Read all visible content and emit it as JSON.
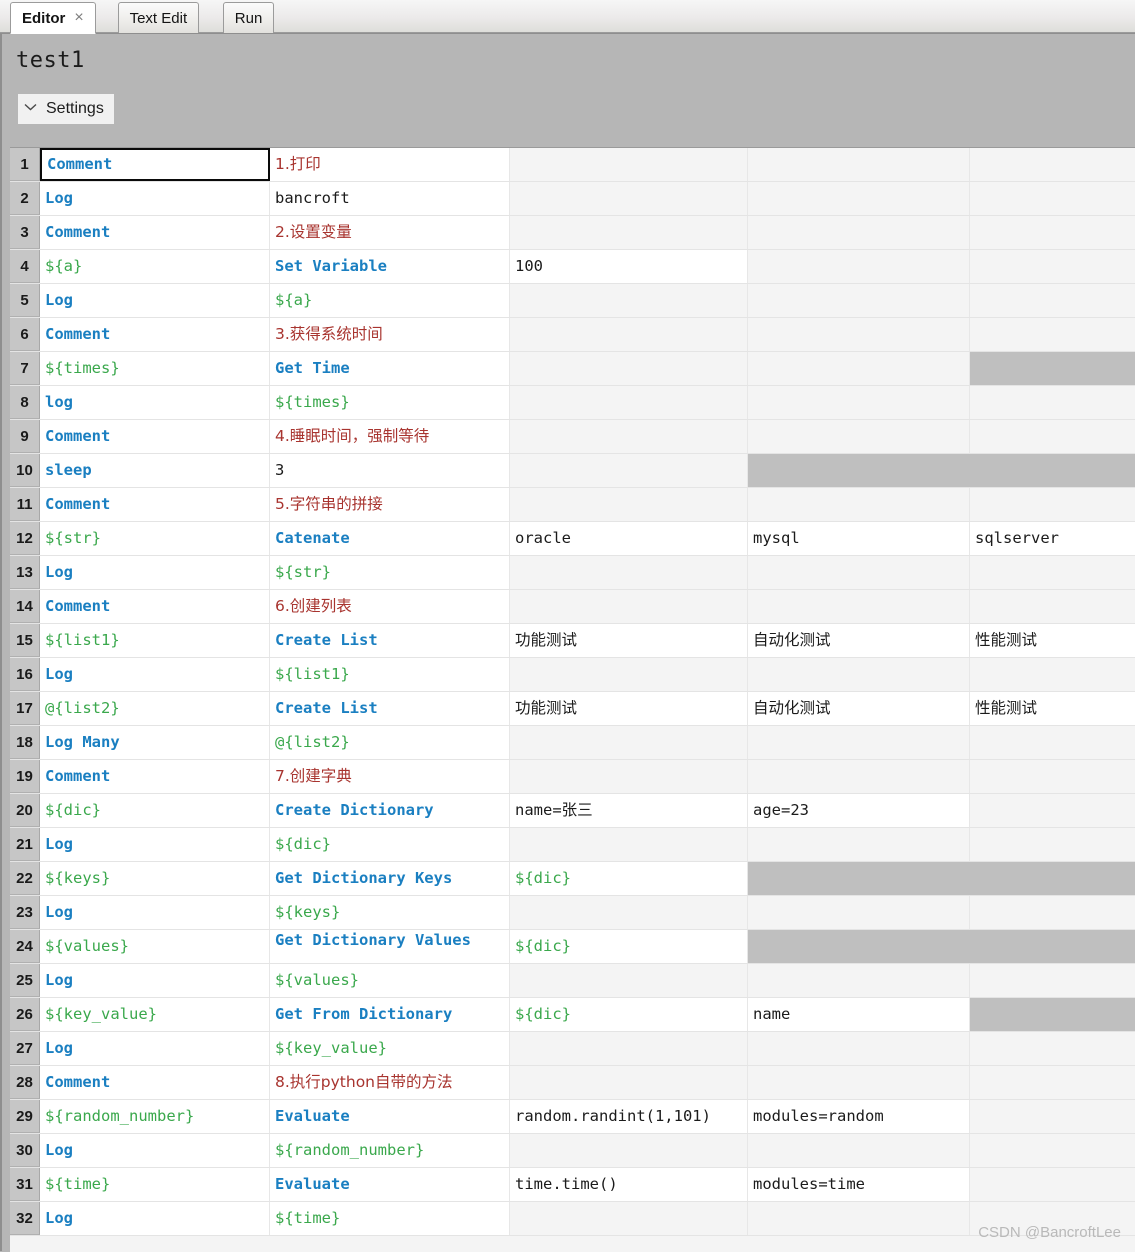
{
  "window": {
    "tabs": [
      {
        "label": "Editor",
        "active": true,
        "closable": true
      },
      {
        "label": "Text Edit",
        "active": false,
        "closable": false
      },
      {
        "label": "Run",
        "active": false,
        "closable": false
      }
    ]
  },
  "editor": {
    "suite_title": "test1",
    "settings_label": "Settings",
    "settings_icon": "chevron-down-icon"
  },
  "colors": {
    "keyword": "#1a7fc1",
    "variable": "#3aa84c",
    "comment": "#a8342f",
    "plain": "#1b1b1b",
    "disabled_cell": "#bfbfbf",
    "empty_cell": "#f4f4f4",
    "row_header": "#c6c6c6",
    "panel": "#b6b6b6"
  },
  "watermark": "CSDN @BancroftLee",
  "grid": {
    "columns": 5,
    "rows": [
      {
        "n": "1",
        "cells": [
          {
            "t": "Comment",
            "k": "kw",
            "sel": true
          },
          {
            "t": "1.打印",
            "k": "cmt",
            "cjk": true
          },
          {
            "t": "",
            "k": ""
          },
          {
            "t": "",
            "k": ""
          },
          {
            "t": "",
            "k": ""
          }
        ]
      },
      {
        "n": "2",
        "cells": [
          {
            "t": "Log",
            "k": "kw"
          },
          {
            "t": "bancroft",
            "k": "txt"
          },
          {
            "t": "",
            "k": ""
          },
          {
            "t": "",
            "k": ""
          },
          {
            "t": "",
            "k": ""
          }
        ]
      },
      {
        "n": "3",
        "cells": [
          {
            "t": "Comment",
            "k": "kw"
          },
          {
            "t": "2.设置变量",
            "k": "cmt",
            "cjk": true
          },
          {
            "t": "",
            "k": ""
          },
          {
            "t": "",
            "k": ""
          },
          {
            "t": "",
            "k": ""
          }
        ]
      },
      {
        "n": "4",
        "cells": [
          {
            "t": "${a}",
            "k": "var"
          },
          {
            "t": "Set Variable",
            "k": "kw"
          },
          {
            "t": "100",
            "k": "txt"
          },
          {
            "t": "",
            "k": ""
          },
          {
            "t": "",
            "k": ""
          }
        ]
      },
      {
        "n": "5",
        "cells": [
          {
            "t": "Log",
            "k": "kw"
          },
          {
            "t": "${a}",
            "k": "var"
          },
          {
            "t": "",
            "k": ""
          },
          {
            "t": "",
            "k": ""
          },
          {
            "t": "",
            "k": ""
          }
        ]
      },
      {
        "n": "6",
        "cells": [
          {
            "t": "Comment",
            "k": "kw"
          },
          {
            "t": "3.获得系统时间",
            "k": "cmt",
            "cjk": true
          },
          {
            "t": "",
            "k": ""
          },
          {
            "t": "",
            "k": ""
          },
          {
            "t": "",
            "k": ""
          }
        ]
      },
      {
        "n": "7",
        "cells": [
          {
            "t": "${times}",
            "k": "var"
          },
          {
            "t": "Get Time",
            "k": "kw"
          },
          {
            "t": "",
            "k": ""
          },
          {
            "t": "",
            "k": ""
          },
          {
            "t": "",
            "k": "",
            "dis": true
          }
        ]
      },
      {
        "n": "8",
        "cells": [
          {
            "t": "log",
            "k": "kw"
          },
          {
            "t": "${times}",
            "k": "var"
          },
          {
            "t": "",
            "k": ""
          },
          {
            "t": "",
            "k": ""
          },
          {
            "t": "",
            "k": ""
          }
        ]
      },
      {
        "n": "9",
        "cells": [
          {
            "t": "Comment",
            "k": "kw"
          },
          {
            "t": "4.睡眠时间，强制等待",
            "k": "cmt",
            "cjk": true
          },
          {
            "t": "",
            "k": ""
          },
          {
            "t": "",
            "k": ""
          },
          {
            "t": "",
            "k": ""
          }
        ]
      },
      {
        "n": "10",
        "cells": [
          {
            "t": "sleep",
            "k": "kw"
          },
          {
            "t": "3",
            "k": "txt"
          },
          {
            "t": "",
            "k": ""
          },
          {
            "t": "",
            "k": "",
            "dis": true
          },
          {
            "t": "",
            "k": "",
            "dis": true
          }
        ]
      },
      {
        "n": "11",
        "cells": [
          {
            "t": "Comment",
            "k": "kw"
          },
          {
            "t": "5.字符串的拼接",
            "k": "cmt",
            "cjk": true
          },
          {
            "t": "",
            "k": ""
          },
          {
            "t": "",
            "k": ""
          },
          {
            "t": "",
            "k": ""
          }
        ]
      },
      {
        "n": "12",
        "cells": [
          {
            "t": "${str}",
            "k": "var"
          },
          {
            "t": "Catenate",
            "k": "kw"
          },
          {
            "t": "oracle",
            "k": "txt"
          },
          {
            "t": "mysql",
            "k": "txt"
          },
          {
            "t": "sqlserver",
            "k": "txt"
          }
        ]
      },
      {
        "n": "13",
        "cells": [
          {
            "t": "Log",
            "k": "kw"
          },
          {
            "t": "${str}",
            "k": "var"
          },
          {
            "t": "",
            "k": ""
          },
          {
            "t": "",
            "k": ""
          },
          {
            "t": "",
            "k": ""
          }
        ]
      },
      {
        "n": "14",
        "cells": [
          {
            "t": "Comment",
            "k": "kw"
          },
          {
            "t": "6.创建列表",
            "k": "cmt",
            "cjk": true
          },
          {
            "t": "",
            "k": ""
          },
          {
            "t": "",
            "k": ""
          },
          {
            "t": "",
            "k": ""
          }
        ]
      },
      {
        "n": "15",
        "cells": [
          {
            "t": "${list1}",
            "k": "var"
          },
          {
            "t": "Create List",
            "k": "kw"
          },
          {
            "t": "功能测试",
            "k": "txt",
            "cjk": true
          },
          {
            "t": "自动化测试",
            "k": "txt",
            "cjk": true
          },
          {
            "t": "性能测试",
            "k": "txt",
            "cjk": true
          }
        ]
      },
      {
        "n": "16",
        "cells": [
          {
            "t": "Log",
            "k": "kw"
          },
          {
            "t": "${list1}",
            "k": "var"
          },
          {
            "t": "",
            "k": ""
          },
          {
            "t": "",
            "k": ""
          },
          {
            "t": "",
            "k": ""
          }
        ]
      },
      {
        "n": "17",
        "cells": [
          {
            "t": "@{list2}",
            "k": "var"
          },
          {
            "t": "Create List",
            "k": "kw"
          },
          {
            "t": "功能测试",
            "k": "txt",
            "cjk": true
          },
          {
            "t": "自动化测试",
            "k": "txt",
            "cjk": true
          },
          {
            "t": "性能测试",
            "k": "txt",
            "cjk": true
          }
        ]
      },
      {
        "n": "18",
        "cells": [
          {
            "t": "Log Many",
            "k": "kw"
          },
          {
            "t": "@{list2}",
            "k": "var"
          },
          {
            "t": "",
            "k": ""
          },
          {
            "t": "",
            "k": ""
          },
          {
            "t": "",
            "k": ""
          }
        ]
      },
      {
        "n": "19",
        "cells": [
          {
            "t": "Comment",
            "k": "kw"
          },
          {
            "t": "7.创建字典",
            "k": "cmt",
            "cjk": true
          },
          {
            "t": "",
            "k": ""
          },
          {
            "t": "",
            "k": ""
          },
          {
            "t": "",
            "k": ""
          }
        ]
      },
      {
        "n": "20",
        "cells": [
          {
            "t": "${dic}",
            "k": "var"
          },
          {
            "t": "Create Dictionary",
            "k": "kw"
          },
          {
            "t": "name=张三",
            "k": "txt"
          },
          {
            "t": "age=23",
            "k": "txt"
          },
          {
            "t": "",
            "k": ""
          }
        ]
      },
      {
        "n": "21",
        "cells": [
          {
            "t": "Log",
            "k": "kw"
          },
          {
            "t": "${dic}",
            "k": "var"
          },
          {
            "t": "",
            "k": ""
          },
          {
            "t": "",
            "k": ""
          },
          {
            "t": "",
            "k": ""
          }
        ]
      },
      {
        "n": "22",
        "cells": [
          {
            "t": "${keys}",
            "k": "var"
          },
          {
            "t": "Get Dictionary Keys",
            "k": "kw"
          },
          {
            "t": "${dic}",
            "k": "var"
          },
          {
            "t": "",
            "k": "",
            "dis": true
          },
          {
            "t": "",
            "k": "",
            "dis": true
          }
        ]
      },
      {
        "n": "23",
        "cells": [
          {
            "t": "Log",
            "k": "kw"
          },
          {
            "t": "${keys}",
            "k": "var"
          },
          {
            "t": "",
            "k": ""
          },
          {
            "t": "",
            "k": ""
          },
          {
            "t": "",
            "k": ""
          }
        ]
      },
      {
        "n": "24",
        "cells": [
          {
            "t": "${values}",
            "k": "var"
          },
          {
            "t": "Get Dictionary Values",
            "k": "kw",
            "wrap": true
          },
          {
            "t": "${dic}",
            "k": "var"
          },
          {
            "t": "",
            "k": "",
            "dis": true
          },
          {
            "t": "",
            "k": "",
            "dis": true
          }
        ]
      },
      {
        "n": "25",
        "cells": [
          {
            "t": "Log",
            "k": "kw"
          },
          {
            "t": "${values}",
            "k": "var"
          },
          {
            "t": "",
            "k": ""
          },
          {
            "t": "",
            "k": ""
          },
          {
            "t": "",
            "k": ""
          }
        ]
      },
      {
        "n": "26",
        "cells": [
          {
            "t": "${key_value}",
            "k": "var"
          },
          {
            "t": "Get From Dictionary",
            "k": "kw"
          },
          {
            "t": "${dic}",
            "k": "var"
          },
          {
            "t": "name",
            "k": "txt"
          },
          {
            "t": "",
            "k": "",
            "dis": true
          }
        ]
      },
      {
        "n": "27",
        "cells": [
          {
            "t": "Log",
            "k": "kw"
          },
          {
            "t": "${key_value}",
            "k": "var"
          },
          {
            "t": "",
            "k": ""
          },
          {
            "t": "",
            "k": ""
          },
          {
            "t": "",
            "k": ""
          }
        ]
      },
      {
        "n": "28",
        "cells": [
          {
            "t": "Comment",
            "k": "kw"
          },
          {
            "t": "8.执行python自带的方法",
            "k": "cmt",
            "cjk": true
          },
          {
            "t": "",
            "k": ""
          },
          {
            "t": "",
            "k": ""
          },
          {
            "t": "",
            "k": ""
          }
        ]
      },
      {
        "n": "29",
        "cells": [
          {
            "t": "${random_number}",
            "k": "var"
          },
          {
            "t": "Evaluate",
            "k": "kw"
          },
          {
            "t": "random.randint(1,101)",
            "k": "txt"
          },
          {
            "t": "modules=random",
            "k": "txt"
          },
          {
            "t": "",
            "k": ""
          }
        ]
      },
      {
        "n": "30",
        "cells": [
          {
            "t": "Log",
            "k": "kw"
          },
          {
            "t": "${random_number}",
            "k": "var"
          },
          {
            "t": "",
            "k": ""
          },
          {
            "t": "",
            "k": ""
          },
          {
            "t": "",
            "k": ""
          }
        ]
      },
      {
        "n": "31",
        "cells": [
          {
            "t": "${time}",
            "k": "var"
          },
          {
            "t": "Evaluate",
            "k": "kw"
          },
          {
            "t": "time.time()",
            "k": "txt"
          },
          {
            "t": "modules=time",
            "k": "txt"
          },
          {
            "t": "",
            "k": ""
          }
        ]
      },
      {
        "n": "32",
        "cells": [
          {
            "t": "Log",
            "k": "kw"
          },
          {
            "t": "${time}",
            "k": "var"
          },
          {
            "t": "",
            "k": ""
          },
          {
            "t": "",
            "k": ""
          },
          {
            "t": "",
            "k": ""
          }
        ]
      }
    ]
  }
}
